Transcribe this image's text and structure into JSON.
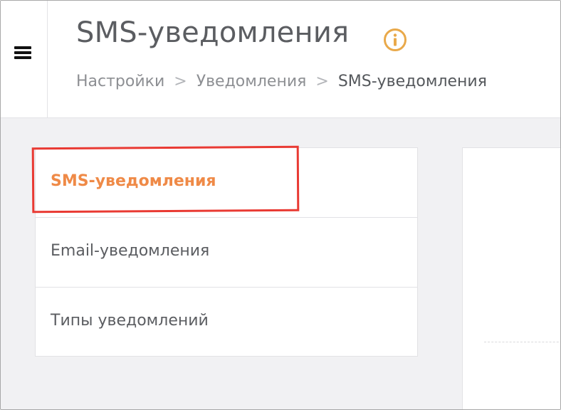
{
  "header": {
    "title": "SMS-уведомления",
    "info_icon": "info-circle-icon",
    "menu_icon": "hamburger-menu-icon"
  },
  "breadcrumb": {
    "items": [
      "Настройки",
      "Уведомления",
      "SMS-уведомления"
    ],
    "separator": ">"
  },
  "sidebar": {
    "items": [
      {
        "label": "SMS-уведомления",
        "active": true
      },
      {
        "label": "Email-уведомления",
        "active": false
      },
      {
        "label": "Типы уведомлений",
        "active": false
      }
    ]
  },
  "colors": {
    "accent": "#ef8a47",
    "highlight": "#e93a33",
    "title_text": "#5b5d61",
    "background": "#f1f1f3",
    "info_icon": "#e9a94a"
  }
}
